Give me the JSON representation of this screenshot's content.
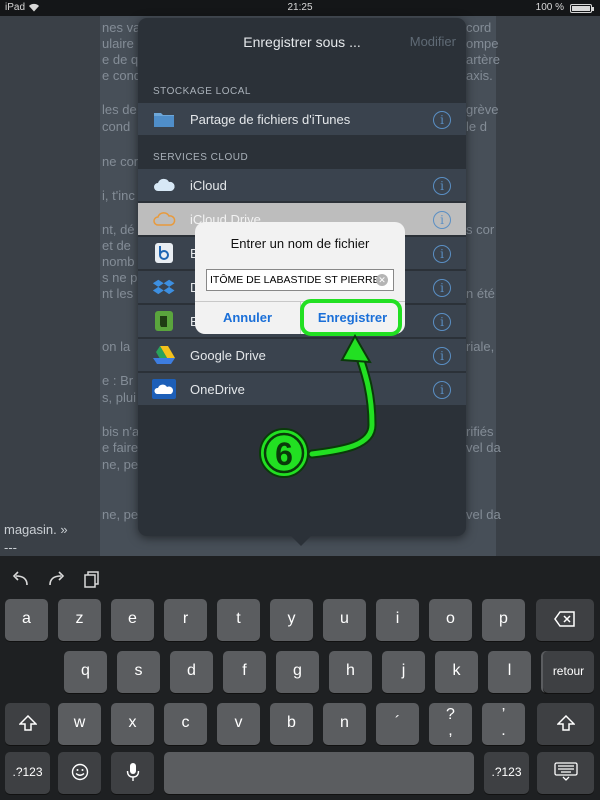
{
  "status_bar": {
    "device": "iPad",
    "time": "21:25",
    "battery": "100 %"
  },
  "document": {
    "lines": [
      "nes va",
      "ulaire c",
      "e de qua",
      "e cond",
      "les de",
      "cond",
      "ne cor",
      "i, t'inc",
      "nt, dé",
      "et de",
      "nomb",
      "s ne p",
      "nt les",
      "on la",
      "e : Br",
      "s, plui",
      "bis n'a",
      "e faire",
      "ne, pe",
      "ne, pe"
    ],
    "right_fragments": [
      "cord",
      "ompe",
      "artère",
      "axis.",
      "grève",
      "le d",
      "s cor",
      "n été",
      "riale,",
      "rifiés",
      "vel da",
      "vel da"
    ],
    "tail_lines": [
      "magasin. »",
      "---"
    ]
  },
  "popover": {
    "title": "Enregistrer sous ...",
    "modify": "Modifier",
    "sections": [
      {
        "label": "STOCKAGE LOCAL",
        "items": [
          {
            "label": "Partage de fichiers d'iTunes",
            "icon": "folder-icon"
          }
        ]
      },
      {
        "label": "SERVICES CLOUD",
        "items": [
          {
            "label": "iCloud",
            "icon": "icloud-icon"
          },
          {
            "label": "iCloud Drive",
            "icon": "icloud-drive-icon"
          },
          {
            "label": "B",
            "icon": "box-icon"
          },
          {
            "label": "D",
            "icon": "dropbox-icon"
          },
          {
            "label": "E",
            "icon": "evernote-icon"
          },
          {
            "label": "Google Drive",
            "icon": "google-drive-icon"
          },
          {
            "label": "OneDrive",
            "icon": "onedrive-icon"
          }
        ]
      }
    ]
  },
  "alert": {
    "title": "Entrer un nom de fichier",
    "input_value": "ITÔME DE LABASTIDE ST PIERRE",
    "cancel": "Annuler",
    "save": "Enregistrer"
  },
  "annotation": {
    "step": "6",
    "color": "#22e022"
  },
  "keyboard": {
    "row1": [
      "a",
      "z",
      "e",
      "r",
      "t",
      "y",
      "u",
      "i",
      "o",
      "p"
    ],
    "row2": [
      "q",
      "s",
      "d",
      "f",
      "g",
      "h",
      "j",
      "k",
      "l",
      "m"
    ],
    "row3": [
      "w",
      "x",
      "c",
      "v",
      "b",
      "n",
      "´",
      "?",
      "’"
    ],
    "row3_sub": {
      "7": ",",
      "8": "."
    },
    "return": "retour",
    "numbers": ".?123"
  }
}
